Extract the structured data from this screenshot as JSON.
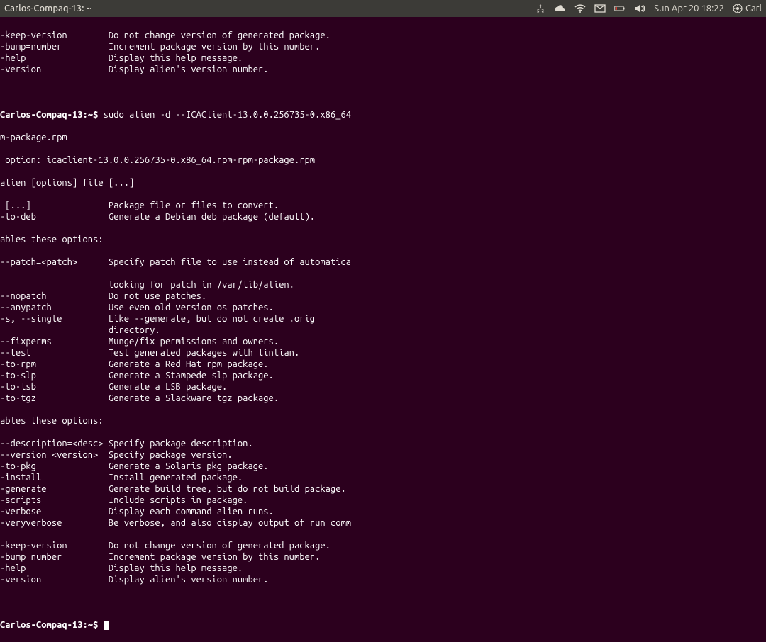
{
  "menubar": {
    "title": "Carlos-Compaq-13: ~",
    "clock": "Sun Apr 20  18:22",
    "user": "Carl"
  },
  "term": {
    "top_opts": [
      {
        "flag": "-keep-version",
        "desc": "Do not change version of generated package."
      },
      {
        "flag": "-bump=number",
        "desc": "Increment package version by this number."
      },
      {
        "flag": "-help",
        "desc": "Display this help message."
      },
      {
        "flag": "-version",
        "desc": "Display alien's version number."
      }
    ],
    "prompt1_host": "Carlos-Compaq-13:",
    "prompt1_path": "~",
    "prompt1_cmd": "sudo alien -d --ICAClient-13.0.0.256735-0.x86_64",
    "line_rpm": "m-package.rpm",
    "line_opt": " option: icaclient-13.0.0.256735-0.x86_64.rpm-rpm-package.rpm",
    "line_usage": "alien [options] file [...]",
    "opts": [
      {
        "flag": " [...]",
        "desc": "Package file or files to convert."
      },
      {
        "flag": "-to-deb",
        "desc": "Generate a Debian deb package (default)."
      }
    ],
    "enables1": "ables these options:",
    "opts2": [
      {
        "flag": "--patch=<patch>",
        "desc": "Specify patch file to use instead of automatica"
      },
      {
        "flag": "",
        "desc": ""
      },
      {
        "flag": "",
        "desc": "looking for patch in /var/lib/alien."
      },
      {
        "flag": "--nopatch",
        "desc": "Do not use patches."
      },
      {
        "flag": "--anypatch",
        "desc": "Use even old version os patches."
      },
      {
        "flag": "-s, --single",
        "desc": "Like --generate, but do not create .orig"
      },
      {
        "flag": "",
        "desc": "directory."
      },
      {
        "flag": "--fixperms",
        "desc": "Munge/fix permissions and owners."
      },
      {
        "flag": "--test",
        "desc": "Test generated packages with lintian."
      },
      {
        "flag": "-to-rpm",
        "desc": "Generate a Red Hat rpm package."
      },
      {
        "flag": "-to-slp",
        "desc": "Generate a Stampede slp package."
      },
      {
        "flag": "-to-lsb",
        "desc": "Generate a LSB package."
      },
      {
        "flag": "-to-tgz",
        "desc": "Generate a Slackware tgz package."
      }
    ],
    "enables2": "ables these options:",
    "opts3": [
      {
        "flag": "--description=<desc>",
        "desc": "Specify package description."
      },
      {
        "flag": "--version=<version>",
        "desc": "Specify package version."
      },
      {
        "flag": "-to-pkg",
        "desc": "Generate a Solaris pkg package."
      },
      {
        "flag": "-install",
        "desc": "Install generated package."
      },
      {
        "flag": "-generate",
        "desc": "Generate build tree, but do not build package."
      },
      {
        "flag": "-scripts",
        "desc": "Include scripts in package."
      },
      {
        "flag": "-verbose",
        "desc": "Display each command alien runs."
      },
      {
        "flag": "-veryverbose",
        "desc": "Be verbose, and also display output of run comm"
      },
      {
        "flag": "",
        "desc": ""
      },
      {
        "flag": "-keep-version",
        "desc": "Do not change version of generated package."
      },
      {
        "flag": "-bump=number",
        "desc": "Increment package version by this number."
      },
      {
        "flag": "-help",
        "desc": "Display this help message."
      },
      {
        "flag": "-version",
        "desc": "Display alien's version number."
      }
    ],
    "prompt2_host": "Carlos-Compaq-13:",
    "prompt2_path": "~"
  }
}
